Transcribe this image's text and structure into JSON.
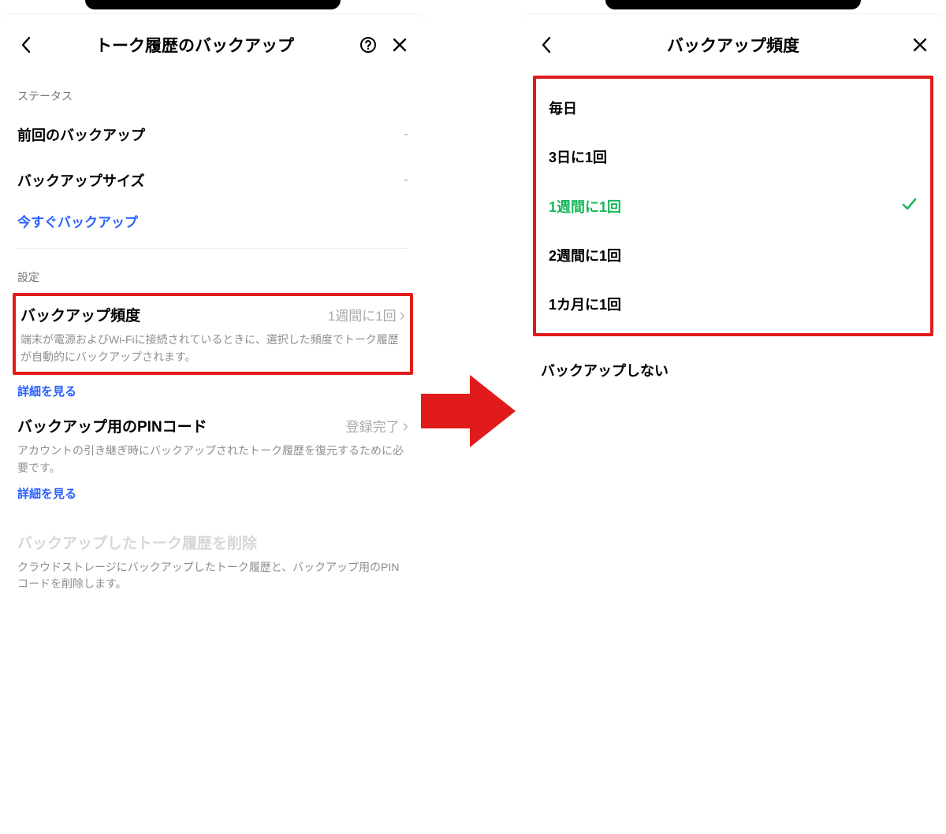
{
  "left": {
    "header_title": "トーク履歴のバックアップ",
    "status_label": "ステータス",
    "last_backup_label": "前回のバックアップ",
    "last_backup_value": "-",
    "backup_size_label": "バックアップサイズ",
    "backup_size_value": "-",
    "backup_now": "今すぐバックアップ",
    "settings_label": "設定",
    "freq_title": "バックアップ頻度",
    "freq_value": "1週間に1回",
    "freq_desc": "端末が電源およびWi-Fiに接続されているときに、選択した頻度でトーク履歴が自動的にバックアップされます。",
    "see_more": "詳細を見る",
    "pin_title": "バックアップ用のPINコード",
    "pin_value": "登録完了",
    "pin_desc": "アカウントの引き継ぎ時にバックアップされたトーク履歴を復元するために必要です。",
    "delete_title": "バックアップしたトーク履歴を削除",
    "delete_desc": "クラウドストレージにバックアップしたトーク履歴と、バックアップ用のPINコードを削除します。"
  },
  "right": {
    "header_title": "バックアップ頻度",
    "options": {
      "o0": "毎日",
      "o1": "3日に1回",
      "o2": "1週間に1回",
      "o3": "2週間に1回",
      "o4": "1カ月に1回"
    },
    "no_backup": "バックアップしない"
  }
}
